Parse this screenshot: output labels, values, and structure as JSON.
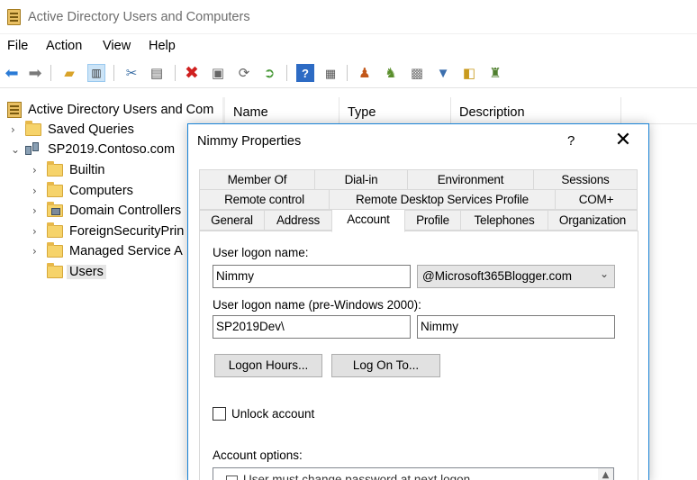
{
  "window": {
    "title": "Active Directory Users and Computers"
  },
  "menu": [
    "File",
    "Action",
    "View",
    "Help"
  ],
  "toolbar": {
    "icons": [
      "back-arrow-icon",
      "forward-arrow-icon",
      "up-folder-icon",
      "show-hide-console-tree-icon",
      "cut-icon",
      "copy-icon",
      "delete-icon",
      "properties-icon",
      "refresh-icon",
      "export-list-icon",
      "help-icon",
      "action-pane-icon",
      "new-user-icon",
      "new-group-icon",
      "new-ou-icon",
      "filter-icon",
      "find-icon",
      "add-to-group-icon"
    ]
  },
  "tree": {
    "root": "Active Directory Users and Com",
    "saved_queries": "Saved Queries",
    "domain": "SP2019.Contoso.com",
    "children": [
      "Builtin",
      "Computers",
      "Domain Controllers",
      "ForeignSecurityPrin",
      "Managed Service A",
      "Users"
    ]
  },
  "list": {
    "columns": [
      "Name",
      "Type",
      "Description"
    ]
  },
  "dialog": {
    "title": "Nimmy Properties",
    "help": "?",
    "close": "✕",
    "tabs_row1": [
      "Member Of",
      "Dial-in",
      "Environment",
      "Sessions"
    ],
    "tabs_row2": [
      "Remote control",
      "Remote Desktop Services Profile",
      "COM+"
    ],
    "tabs_row3": [
      "General",
      "Address",
      "Account",
      "Profile",
      "Telephones",
      "Organization"
    ],
    "active_tab": "Account",
    "logon_name_label": "User logon name:",
    "logon_name_value": "Nimmy",
    "domain_suffix": "@Microsoft365Blogger.com",
    "pre2000_label": "User logon name (pre-Windows 2000):",
    "pre2000_domain": "SP2019Dev\\",
    "pre2000_user": "Nimmy",
    "logon_hours_button": "Logon Hours...",
    "logon_to_button": "Log On To...",
    "unlock_label": "Unlock account",
    "unlock_checked": false,
    "account_options_label": "Account options:",
    "account_option_first": "User must change password at next logon"
  }
}
